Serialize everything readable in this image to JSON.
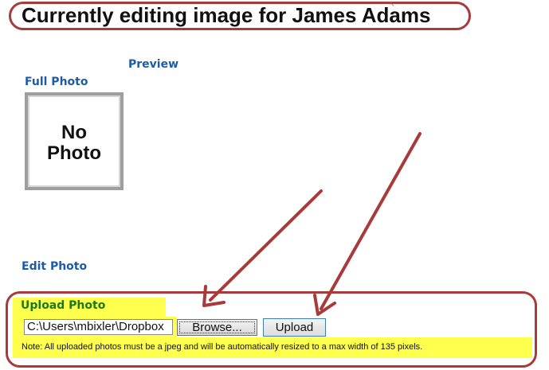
{
  "header": {
    "title": "Currently editing image for James Adams"
  },
  "preview": {
    "heading": "Preview",
    "full_photo_heading": "Full Photo",
    "no_photo_line1": "No",
    "no_photo_line2": "Photo"
  },
  "edit": {
    "heading": "Edit Photo"
  },
  "upload": {
    "heading": "Upload Photo",
    "file_value": "C:\\Users\\mbixler\\Dropbox",
    "browse_label": "Browse...",
    "upload_label": "Upload",
    "note": "Note: All uploaded photos must be a jpeg and will be automatically resized to a max width of 135 pixels."
  },
  "colors": {
    "annotation": "#a83a3a",
    "highlight": "#ffff4d",
    "heading_blue": "#1e5aa8",
    "heading_green": "#1a7a1a"
  }
}
